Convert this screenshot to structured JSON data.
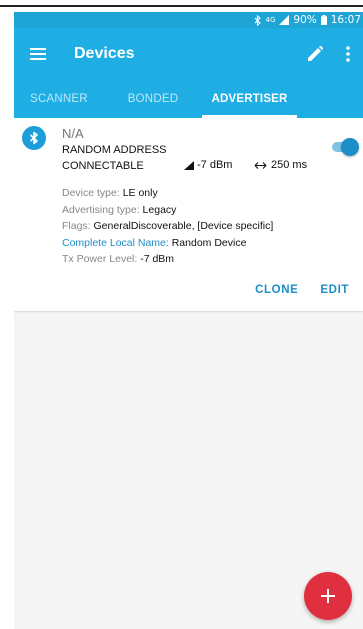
{
  "status_bar": {
    "bluetooth_icon": "bluetooth-icon",
    "network_type": "4G",
    "signal_icon": "signal-icon",
    "battery_percent": "90%",
    "battery_icon": "battery-icon",
    "time": "16:07"
  },
  "app_bar": {
    "menu_icon": "hamburger-menu-icon",
    "title": "Devices",
    "edit_icon": "pencil-icon",
    "more_icon": "more-vert-icon"
  },
  "tabs": [
    {
      "label": "SCANNER",
      "selected": false
    },
    {
      "label": "BONDED",
      "selected": false
    },
    {
      "label": "ADVERTISER",
      "selected": true
    }
  ],
  "advertiser": {
    "icon": "bluetooth-icon",
    "name": "N/A",
    "address_type": "RANDOM ADDRESS",
    "connectable": "CONNECTABLE",
    "tx_power": "-7 dBm",
    "interval": "250 ms",
    "enabled": true,
    "details": {
      "device_type_label": "Device type: ",
      "device_type_value": "LE only",
      "advertising_type_label": "Advertising type: ",
      "advertising_type_value": "Legacy",
      "flags_label": "Flags: ",
      "flags_value": "GeneralDiscoverable, [Device specific]",
      "local_name_label": "Complete Local Name: ",
      "local_name_value": "Random Device",
      "tx_power_level_label": "Tx Power Level: ",
      "tx_power_level_value": "-7 dBm"
    },
    "clone_label": "CLONE",
    "edit_label": "EDIT"
  },
  "fab": {
    "icon": "plus-icon"
  },
  "colors": {
    "primary": "#1eaee3",
    "status_bar": "#1ea5d6",
    "accent": "#1c8ec8",
    "fab": "#e0303f"
  }
}
